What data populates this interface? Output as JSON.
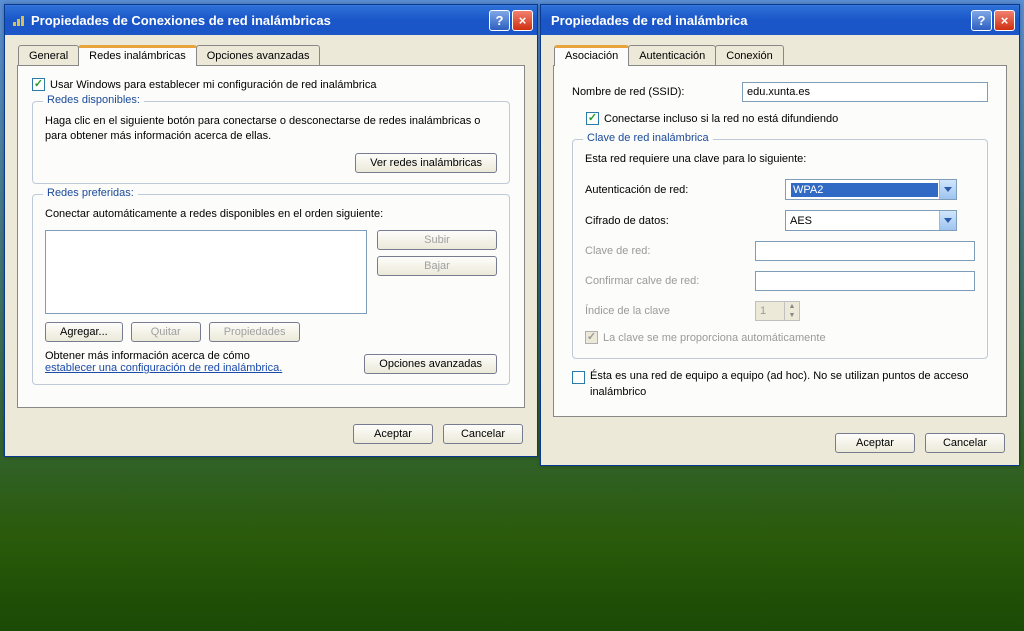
{
  "window1": {
    "title": "Propiedades de Conexiones de red inalámbricas",
    "tabs": {
      "general": "General",
      "wifi": "Redes inalámbricas",
      "advanced": "Opciones avanzadas"
    },
    "use_windows": "Usar Windows para establecer mi configuración de red inalámbrica",
    "available": {
      "legend": "Redes disponibles:",
      "desc": "Haga clic en el siguiente botón para conectarse o desconectarse de redes inalámbricas o para obtener más información acerca de ellas.",
      "view_btn": "Ver redes inalámbricas"
    },
    "preferred": {
      "legend": "Redes preferidas:",
      "desc": "Conectar automáticamente a redes disponibles en el orden siguiente:",
      "up": "Subir",
      "down": "Bajar",
      "add": "Agregar...",
      "remove": "Quitar",
      "props": "Propiedades"
    },
    "learn": {
      "line1": "Obtener más información acerca de cómo",
      "link": "establecer una configuración de red inalámbrica."
    },
    "adv_btn": "Opciones avanzadas",
    "ok": "Aceptar",
    "cancel": "Cancelar"
  },
  "window2": {
    "title": "Propiedades de red inalámbrica",
    "tabs": {
      "assoc": "Asociación",
      "auth": "Autenticación",
      "conn": "Conexión"
    },
    "ssid_label": "Nombre de red (SSID):",
    "ssid_value": "edu.xunta.es",
    "connect_nb": "Conectarse incluso si la red no está difundiendo",
    "key": {
      "legend": "Clave de red inalámbrica",
      "desc": "Esta red requiere una clave para lo siguiente:",
      "auth_label": "Autenticación de red:",
      "auth_value": "WPA2",
      "enc_label": "Cifrado de datos:",
      "enc_value": "AES",
      "netkey_label": "Clave de red:",
      "confirm_label": "Confirmar calve de red:",
      "index_label": "Índice de la clave",
      "index_value": "1",
      "auto_key": "La clave se me proporciona automáticamente"
    },
    "adhoc": "Ésta es una red de equipo a equipo (ad hoc). No se utilizan puntos de acceso inalámbrico",
    "ok": "Aceptar",
    "cancel": "Cancelar"
  }
}
